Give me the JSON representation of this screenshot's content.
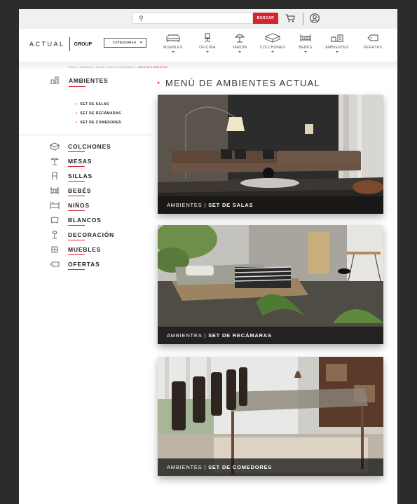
{
  "search": {
    "placeholder": "",
    "button_label": "BUSCAR"
  },
  "logo": {
    "word": "ACTUAL",
    "group": "GROUP"
  },
  "categories_button": "CATEGORÍAS",
  "nav": [
    {
      "label": "MUEBLES",
      "icon": "sofa-icon"
    },
    {
      "label": "OFICINA",
      "icon": "office-chair-icon"
    },
    {
      "label": "JARDÍN",
      "icon": "umbrella-icon"
    },
    {
      "label": "COLCHONES",
      "icon": "mattress-icon"
    },
    {
      "label": "BEBÉS",
      "icon": "crib-icon"
    },
    {
      "label": "AMBIENTES",
      "icon": "room-icon"
    },
    {
      "label": "OFERTAS",
      "icon": "tag-icon"
    }
  ],
  "breadcrumb": {
    "path": "INICIO • MUEBLES • SALAS • SALAS ESQUINERAS •",
    "current": "SALA DE 3 ASIENTOS"
  },
  "sidebar": {
    "ambientes_title": "AMBIENTES",
    "subitems": [
      "SET DE SALAS",
      "SET DE RECÁMARAS",
      "SET DE COMEDORES"
    ],
    "categories": [
      {
        "label": "COLCHONES",
        "icon": "mattress-icon"
      },
      {
        "label": "MESAS",
        "icon": "table-icon"
      },
      {
        "label": "SILLAS",
        "icon": "chair-icon"
      },
      {
        "label": "BEBÉS",
        "icon": "crib-icon"
      },
      {
        "label": "NIÑOS",
        "icon": "bunk-bed-icon"
      },
      {
        "label": "BLANCOS",
        "icon": "pillow-icon"
      },
      {
        "label": "DECORACIÓN",
        "icon": "lamp-icon"
      },
      {
        "label": "MUEBLES",
        "icon": "dresser-icon"
      },
      {
        "label": "OFERTAS",
        "icon": "tag-icon"
      }
    ]
  },
  "main": {
    "title": "MENÚ DE AMBIENTES ACTUAL",
    "cards": [
      {
        "prefix": "AMBIENTES |",
        "name": "SET DE SALAS"
      },
      {
        "prefix": "AMBIENTES |",
        "name": "SET DE RECÁMARAS"
      },
      {
        "prefix": "AMBIENTES |",
        "name": "SET DE COMEDORES"
      }
    ]
  },
  "colors": {
    "accent": "#d3262e",
    "background": "#2c2c2c",
    "topbar": "#f0f0f0"
  }
}
